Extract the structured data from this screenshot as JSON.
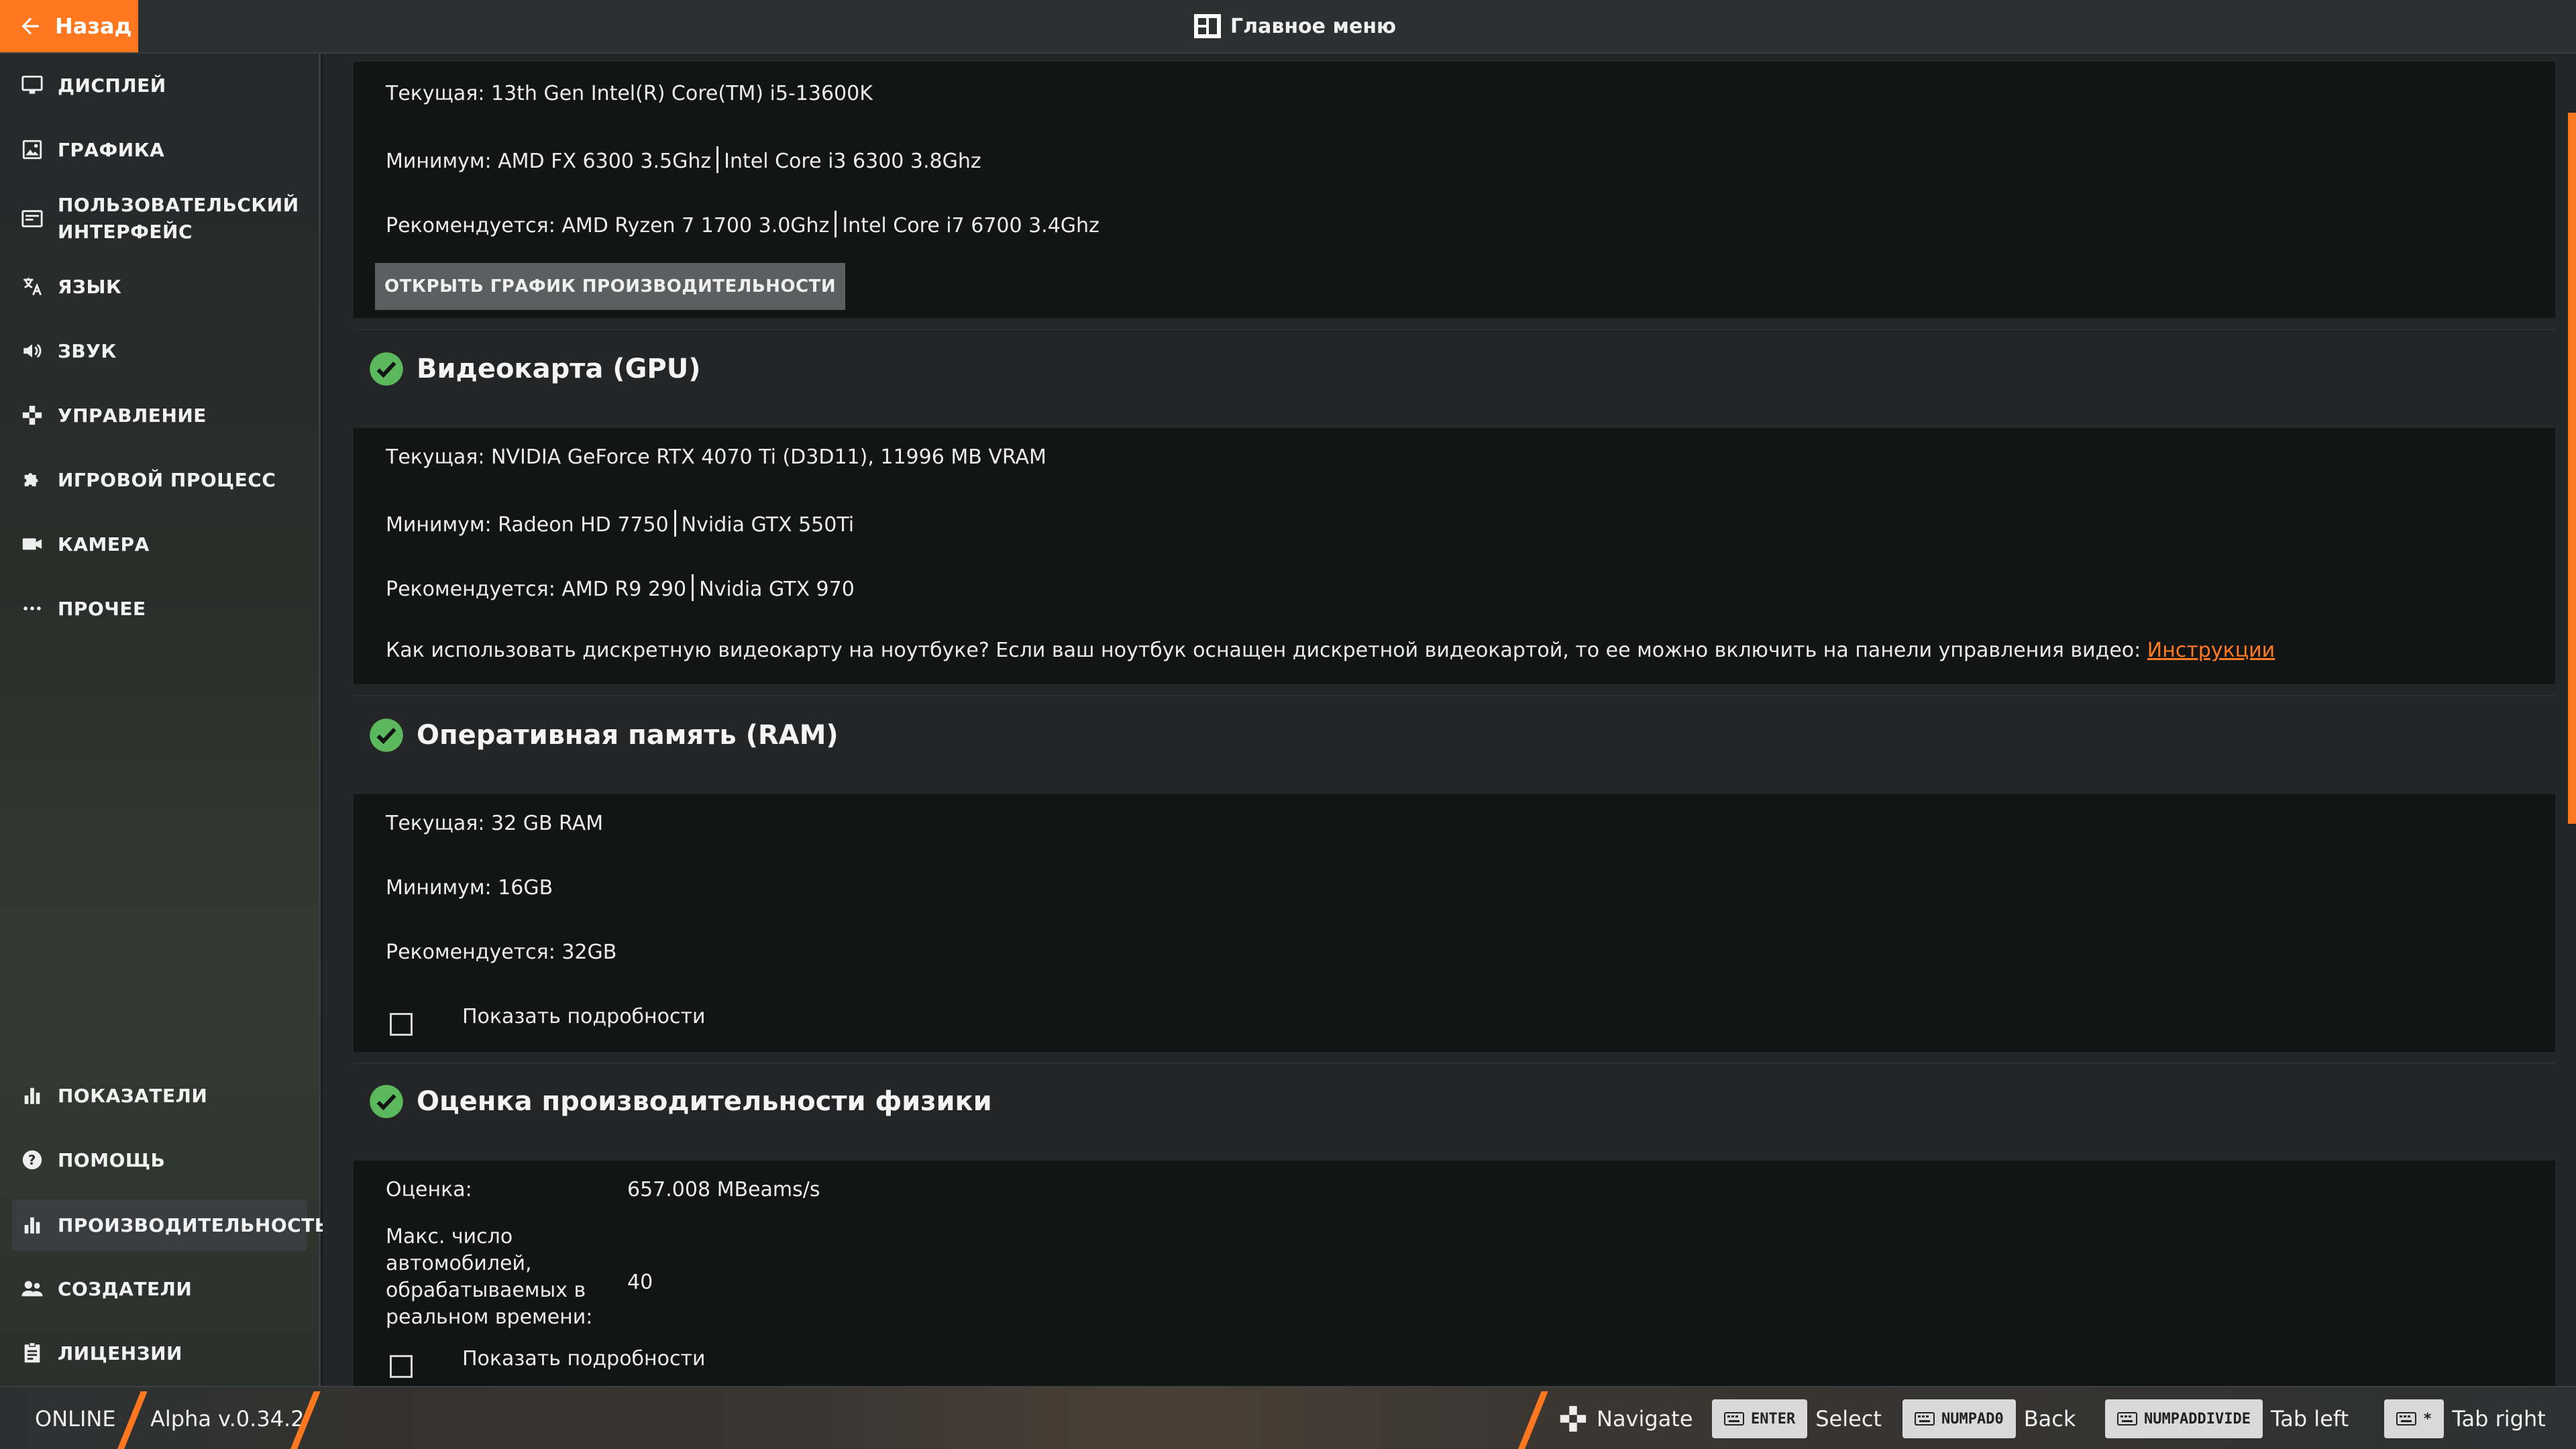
{
  "topbar": {
    "back_label": "Назад",
    "main_menu_label": "Главное меню"
  },
  "sidebar": {
    "items": [
      {
        "label": "Дисплей",
        "icon": "monitor-icon"
      },
      {
        "label": "Графика",
        "icon": "image-icon"
      },
      {
        "label": "Пользовательский интерфейс",
        "icon": "ui-icon"
      },
      {
        "label": "Язык",
        "icon": "translate-icon"
      },
      {
        "label": "Звук",
        "icon": "speaker-icon"
      },
      {
        "label": "Управление",
        "icon": "gamepad-icon"
      },
      {
        "label": "Игровой процесс",
        "icon": "puzzle-icon"
      },
      {
        "label": "Камера",
        "icon": "camera-icon"
      },
      {
        "label": "Прочее",
        "icon": "ellipsis-icon"
      }
    ],
    "bottom_items": [
      {
        "label": "Показатели",
        "icon": "stats-icon"
      },
      {
        "label": "Помощь",
        "icon": "help-icon"
      },
      {
        "label": "Производительность",
        "icon": "performance-icon",
        "active": true
      },
      {
        "label": "Создатели",
        "icon": "people-icon"
      },
      {
        "label": "Лицензии",
        "icon": "license-icon"
      }
    ]
  },
  "cpu": {
    "current": "Текущая: 13th Gen Intel(R) Core(TM) i5-13600K",
    "minimum_a": "Минимум: AMD FX 6300 3.5Ghz",
    "minimum_b": "Intel Core i3 6300 3.8Ghz",
    "recommended_a": "Рекомендуется: AMD Ryzen 7 1700 3.0Ghz",
    "recommended_b": "Intel Core i7 6700 3.4Ghz",
    "open_graph_button": "ОТКРЫТЬ ГРАФИК ПРОИЗВОДИТЕЛЬНОСТИ"
  },
  "gpu": {
    "title": "Видеокарта (GPU)",
    "current": "Текущая: NVIDIA GeForce RTX 4070 Ti (D3D11), 11996 MB VRAM",
    "minimum_a": "Минимум: Radeon HD 7750",
    "minimum_b": "Nvidia GTX 550Ti",
    "recommended_a": "Рекомендуется: AMD R9 290",
    "recommended_b": "Nvidia GTX 970",
    "laptop_note": "Как использовать дискретную видеокарту на ноутбуке? Если ваш ноутбук оснащен дискретной видеокартой, то ее можно включить на панели управления видео: ",
    "instructions_link": "Инструкции"
  },
  "ram": {
    "title": "Оперативная память (RAM)",
    "current": "Текущая: 32 GB RAM",
    "minimum": "Минимум: 16GB",
    "recommended": "Рекомендуется: 32GB",
    "show_details": "Показать подробности"
  },
  "physics": {
    "title": "Оценка производительности физики",
    "score_label": "Оценка:",
    "score_value": "657.008 MBeams/s",
    "max_cars_label": "Макс. число автомобилей, обрабатываемых в реальном времени:",
    "max_cars_value": "40",
    "show_details": "Показать подробности"
  },
  "bottombar": {
    "status": "ONLINE",
    "version": "Alpha v.0.34.2",
    "hints": [
      {
        "key": "",
        "action": "Navigate"
      },
      {
        "key": "ENTER",
        "action": "Select"
      },
      {
        "key": "NUMPAD0",
        "action": "Back"
      },
      {
        "key": "NUMPADDIVIDE",
        "action": "Tab left"
      },
      {
        "key": "*",
        "action": "Tab right"
      }
    ]
  },
  "colors": {
    "accent": "#ff7820",
    "check_green": "#5cb85c",
    "panel_bg": "#131414"
  }
}
